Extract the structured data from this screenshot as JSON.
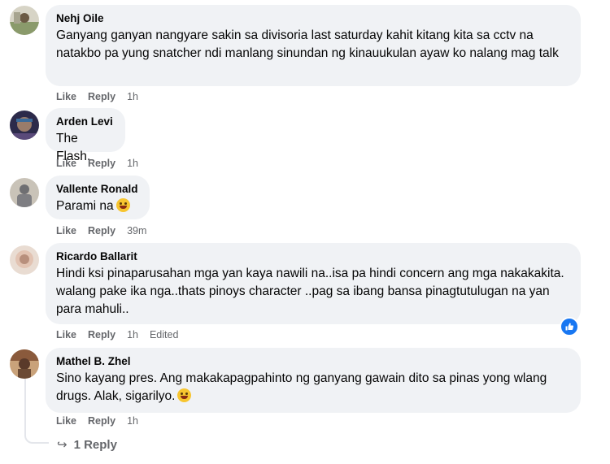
{
  "comments": [
    {
      "author": "Nehj Oile",
      "text": "Ganyang ganyan nangyare sakin sa divisoria last saturday kahit kitang kita sa cctv na natakbo pa yung snatcher ndi manlang sinundan ng kinauukulan ayaw ko nalang mag talk",
      "like": "Like",
      "reply": "Reply",
      "time": "1h",
      "avatar_colors": [
        "#8a9a6b",
        "#d7d4c6"
      ]
    },
    {
      "author": "Arden Levi",
      "text": "The Flash.",
      "like": "Like",
      "reply": "Reply",
      "time": "1h",
      "avatar_colors": [
        "#2c2a4a",
        "#9a7c6a"
      ]
    },
    {
      "author": "Vallente Ronald",
      "text": "Parami na",
      "like": "Like",
      "reply": "Reply",
      "time": "39m",
      "emoji": "laughing-emoji",
      "avatar_colors": [
        "#c9c3b8",
        "#6f6f72"
      ]
    },
    {
      "author": "Ricardo Ballarit",
      "text": "Hindi ksi pinaparusahan mga yan kaya nawili na..isa pa hindi concern ang mga nakakakita. walang pake ika nga..thats pinoys character ..pag sa ibang bansa pinagtutulugan na yan para mahuli..",
      "like": "Like",
      "reply": "Reply",
      "time": "1h",
      "edited": "Edited",
      "avatar_colors": [
        "#e2c3b2",
        "#b88f7c"
      ]
    },
    {
      "author": "Mathel B. Zhel",
      "text": "Sino kayang pres. Ang makakapagpahinto ng ganyang gawain dito sa pinas yong wlang drugs. Alak, sigarilyo.",
      "like": "Like",
      "reply": "Reply",
      "time": "1h",
      "emoji": "smiling-emoji",
      "avatar_colors": [
        "#8a5a3c",
        "#c9a27a"
      ]
    }
  ],
  "replies_link": "1 Reply",
  "colors": {
    "bubble": "#f0f2f5",
    "meta": "#65676b",
    "like_blue": "#1877f2"
  }
}
